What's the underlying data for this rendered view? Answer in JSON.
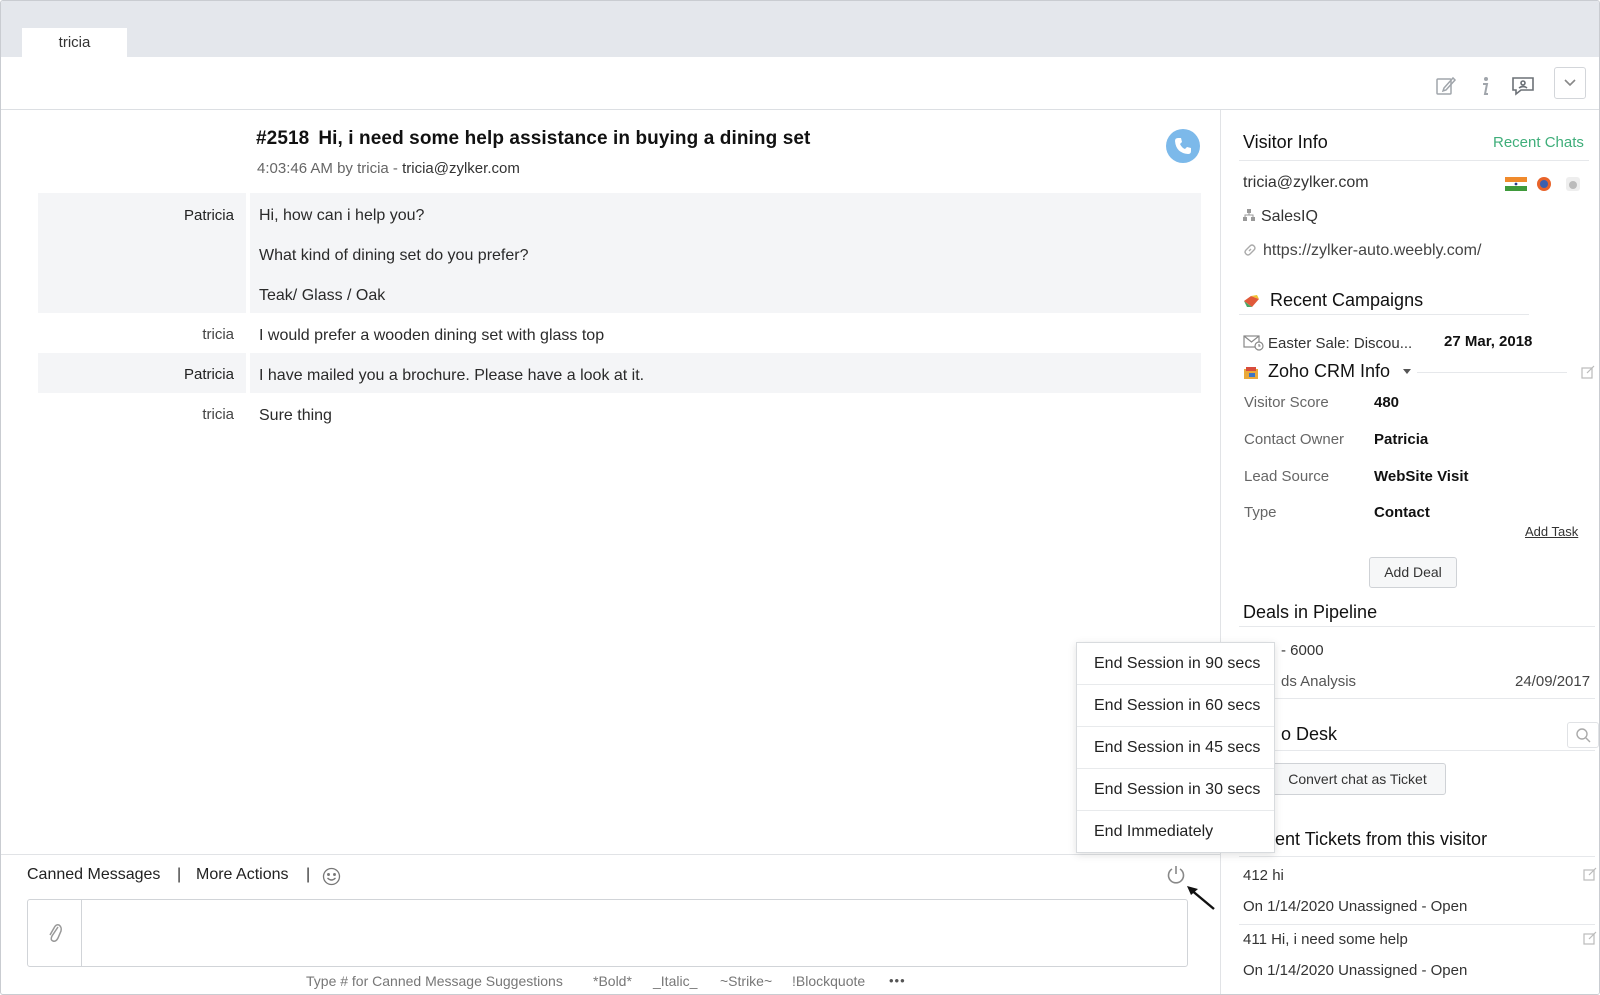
{
  "tab": {
    "label": "tricia"
  },
  "chat": {
    "ticket_id": "#2518",
    "subject": "Hi, i need some help assistance in buying a dining set",
    "time": "4:03:46 AM",
    "by_text": "by tricia -",
    "email": "tricia@zylker.com",
    "messages": [
      {
        "author": "Patricia",
        "lines": [
          "Hi, how can i help you?",
          "What kind of dining set do you prefer?",
          "Teak/ Glass / Oak"
        ]
      },
      {
        "author": "tricia",
        "lines": [
          "I would prefer a wooden dining set with glass top"
        ]
      },
      {
        "author": "Patricia",
        "lines": [
          "I have mailed you a brochure. Please have a look at it."
        ]
      },
      {
        "author": "tricia",
        "lines": [
          "Sure thing"
        ]
      }
    ]
  },
  "composer": {
    "canned_messages": "Canned Messages",
    "separator": "|",
    "more_actions": "More Actions",
    "placeholder": "",
    "hints": [
      "Type # for Canned Message Suggestions",
      "*Bold*",
      "_Italic_",
      "~Strike~",
      "!Blockquote",
      "•••"
    ]
  },
  "end_menu": {
    "items": [
      "End Session in 90 secs",
      "End Session in 60 secs",
      "End Session in 45 secs",
      "End Session in 30 secs",
      "End Immediately"
    ]
  },
  "visitor": {
    "title": "Visitor Info",
    "recent_chats": "Recent Chats",
    "email": "tricia@zylker.com",
    "department": "SalesIQ",
    "url": "https://zylker-auto.weebly.com/"
  },
  "campaigns": {
    "title": "Recent Campaigns",
    "name": "Easter Sale: Discou...",
    "date": "27 Mar, 2018"
  },
  "crm": {
    "title": "Zoho CRM Info",
    "fields": [
      {
        "label": "Visitor Score",
        "value": "480"
      },
      {
        "label": "Contact Owner",
        "value": "Patricia"
      },
      {
        "label": "Lead Source",
        "value": "WebSite Visit"
      },
      {
        "label": "Type",
        "value": "Contact"
      }
    ],
    "add_task": "Add Task",
    "add_deal": "Add Deal"
  },
  "deals": {
    "title": "Deals in Pipeline",
    "amount_partial": "- 6000",
    "name_partial": "ds Analysis",
    "date": "24/09/2017"
  },
  "desk": {
    "title_partial": "o Desk",
    "convert": "Convert chat as Ticket"
  },
  "tickets": {
    "title": "Recent Tickets from this visitor",
    "items": [
      {
        "title": "412 hi",
        "date": "On 1/14/2020",
        "status": "Unassigned - Open"
      },
      {
        "title": "411 Hi, i need some help",
        "date": "On 1/14/2020",
        "status": "Unassigned - Open"
      }
    ]
  },
  "colors": {
    "accent_green": "#3fae7a",
    "call_blue": "#7cb9ea"
  }
}
